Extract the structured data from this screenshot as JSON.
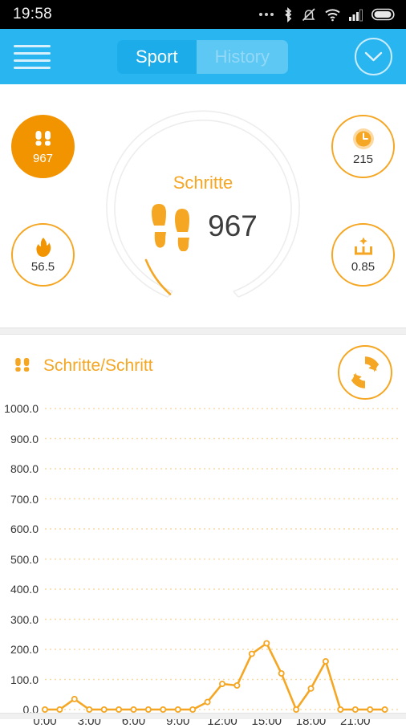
{
  "status_bar": {
    "time": "19:58",
    "icons": [
      "more-dots-icon",
      "bluetooth-icon",
      "mute-vibrate-icon",
      "wifi-icon",
      "signal-icon",
      "battery-icon"
    ]
  },
  "top_bar": {
    "menu_icon": "hamburger-menu-icon",
    "tabs": [
      {
        "label": "Sport",
        "active": true
      },
      {
        "label": "History",
        "active": false
      }
    ],
    "expand_icon": "chevron-down-icon",
    "background_color": "#29b6f0",
    "active_tab_color": "#1cacea",
    "inactive_tab_color": "#5cc8f3"
  },
  "dashboard": {
    "gauge": {
      "title": "Schritte",
      "value": "967",
      "icon": "footsteps-icon",
      "progress_percent": 9.7,
      "track_color": "#ebebeb",
      "progress_color": "#f5a623"
    },
    "badges": [
      {
        "id": "steps",
        "icon": "footsteps-icon",
        "value": "967",
        "style": "filled"
      },
      {
        "id": "time",
        "icon": "clock-icon",
        "value": "215",
        "style": "outline"
      },
      {
        "id": "calories",
        "icon": "flame-icon",
        "value": "56.5",
        "style": "outline"
      },
      {
        "id": "distance",
        "icon": "distance-icon",
        "value": "0.85",
        "style": "outline"
      }
    ],
    "accent_color": "#f5a623",
    "filled_badge_color": "#f29400"
  },
  "chart_section": {
    "icon": "footsteps-icon",
    "label": "Schritte/Schritt",
    "sync_icon": "refresh-sync-icon"
  },
  "chart_data": {
    "type": "line",
    "title": "Schritte/Schritt",
    "xlabel": "",
    "ylabel": "",
    "ylim": [
      0,
      1000
    ],
    "xlim": [
      0,
      24
    ],
    "grid": true,
    "legend": null,
    "y_ticks": [
      "0.0",
      "100.0",
      "200.0",
      "300.0",
      "400.0",
      "500.0",
      "600.0",
      "700.0",
      "800.0",
      "900.0",
      "1000.0"
    ],
    "y_tick_values": [
      0,
      100,
      200,
      300,
      400,
      500,
      600,
      700,
      800,
      900,
      1000
    ],
    "x_ticks": [
      "0:00",
      "3:00",
      "6:00",
      "9:00",
      "12:00",
      "15:00",
      "18:00",
      "21:00"
    ],
    "x_tick_values": [
      0,
      3,
      6,
      9,
      12,
      15,
      18,
      21
    ],
    "line_color": "#f5a623",
    "marker": "circle-open",
    "x": [
      0,
      1,
      2,
      3,
      4,
      5,
      6,
      7,
      8,
      9,
      10,
      11,
      12,
      13,
      14,
      15,
      16,
      17,
      18,
      19,
      20,
      21,
      22,
      23
    ],
    "values": [
      0,
      0,
      35,
      0,
      0,
      0,
      0,
      0,
      0,
      0,
      0,
      25,
      85,
      80,
      185,
      220,
      120,
      0,
      70,
      160,
      0,
      0,
      0,
      0
    ],
    "series": [
      {
        "name": "Schritte/Schritt",
        "values": [
          0,
          0,
          35,
          0,
          0,
          0,
          0,
          0,
          0,
          0,
          0,
          25,
          85,
          80,
          185,
          220,
          120,
          0,
          70,
          160,
          0,
          0,
          0,
          0
        ]
      }
    ]
  }
}
